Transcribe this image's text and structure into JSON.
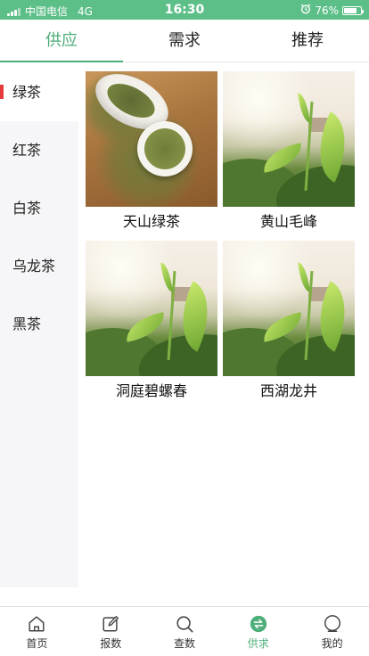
{
  "status_bar": {
    "carrier": "中国电信",
    "network": "4G",
    "time": "16:30",
    "battery_percent": "76%",
    "battery_level": 0.76,
    "background": "#5dbf88"
  },
  "top_tabs": [
    {
      "label": "供应",
      "active": true
    },
    {
      "label": "需求",
      "active": false
    },
    {
      "label": "推荐",
      "active": false
    }
  ],
  "accent_color": "#4fae7a",
  "sidebar": {
    "items": [
      {
        "label": "绿茶",
        "active": true
      },
      {
        "label": "红茶",
        "active": false
      },
      {
        "label": "白茶",
        "active": false
      },
      {
        "label": "乌龙茶",
        "active": false
      },
      {
        "label": "黑茶",
        "active": false
      }
    ]
  },
  "products": [
    {
      "name": "天山绿茶",
      "image": "green-tea-cup-photo"
    },
    {
      "name": "黄山毛峰",
      "image": "tea-leaf-field-photo"
    },
    {
      "name": "洞庭碧螺春",
      "image": "tea-leaf-field-photo"
    },
    {
      "name": "西湖龙井",
      "image": "tea-leaf-field-photo"
    }
  ],
  "bottom_nav": [
    {
      "label": "首页",
      "icon": "home-icon",
      "active": false
    },
    {
      "label": "报数",
      "icon": "edit-icon",
      "active": false
    },
    {
      "label": "查数",
      "icon": "search-icon",
      "active": false
    },
    {
      "label": "供求",
      "icon": "exchange-icon",
      "active": true
    },
    {
      "label": "我的",
      "icon": "user-icon",
      "active": false
    }
  ]
}
